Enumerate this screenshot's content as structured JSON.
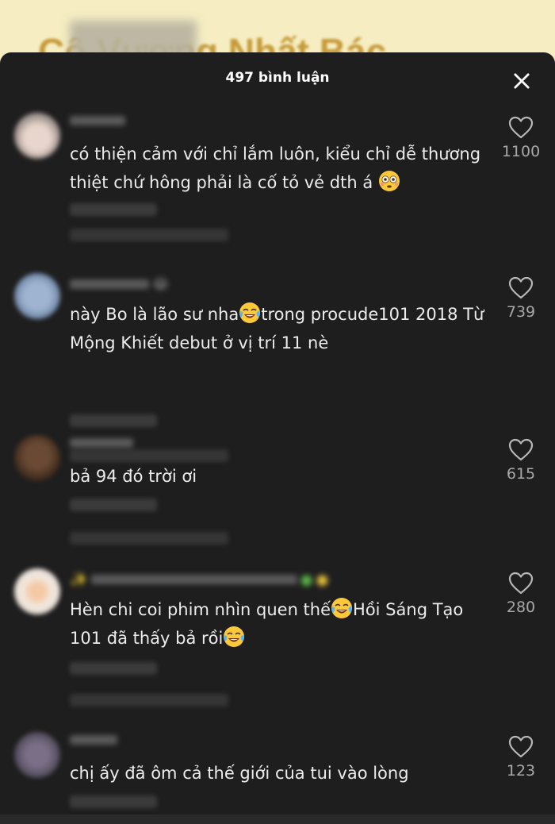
{
  "video_title": "Cô Vương Nhất Bác",
  "header": {
    "comment_count": "497 bình luận",
    "close_icon": "close-icon"
  },
  "comments": [
    {
      "username": "",
      "text": "có thiện cảm với chỉ lắm luôn, kiểu chỉ dễ thương thiệt chứ hông phải là cố tỏ vẻ dth á",
      "emoji": "flushed-face",
      "likes": "1100"
    },
    {
      "username": "",
      "text_parts": [
        "này Bo là lão sư nha",
        "trong procude101 2018 Từ Mộng Khiết debut ở vị trí 11 nè"
      ],
      "emoji": "tears-of-joy",
      "likes": "739"
    },
    {
      "username": "",
      "text": "bả 94 đó trời ơi",
      "likes": "615"
    },
    {
      "username": "",
      "text_parts": [
        "Hèn chi coi phim nhìn quen thế",
        "Hồi Sáng Tạo 101 đã thấy bả rồi"
      ],
      "emoji": "tears-of-joy",
      "likes": "280"
    },
    {
      "username": "",
      "text": "chị ấy đã ôm cả thế giới của tui vào lòng",
      "likes": "123"
    }
  ],
  "colors": {
    "sheet_bg": "#1e1e1e",
    "text": "#ececec",
    "like_count": "#a8a8a8",
    "video_bg": "#f6eec2"
  }
}
